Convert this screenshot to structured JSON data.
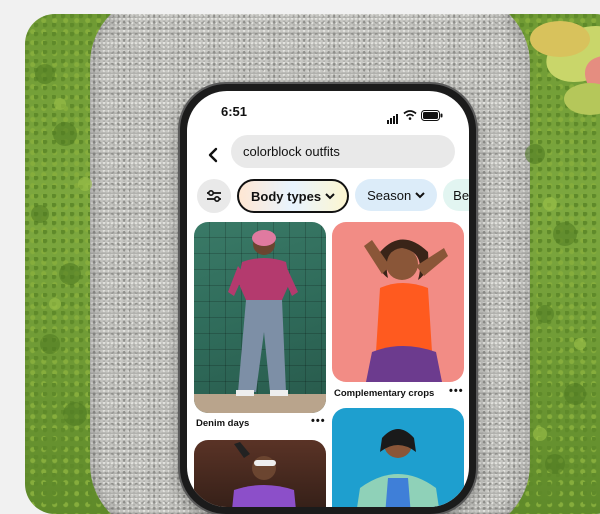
{
  "status_bar": {
    "time": "6:51"
  },
  "search": {
    "query": "colorblock outfits"
  },
  "filters": [
    {
      "label": "Body types"
    },
    {
      "label": "Season"
    },
    {
      "label": "Best"
    }
  ],
  "pins": [
    {
      "title": "Denim days"
    },
    {
      "title": "Complementary crops"
    }
  ],
  "icons": {
    "back": "chevron-left-icon",
    "filter": "sliders-icon",
    "more": "more-dots-icon"
  },
  "colors": {
    "grass": "#7da83f",
    "gravel": "#b2b2ae",
    "tile_green": "#2f6b5a",
    "coral_bg": "#f28c85",
    "orange_top": "#ff5a1f",
    "blue_bg": "#1e9fcf"
  }
}
